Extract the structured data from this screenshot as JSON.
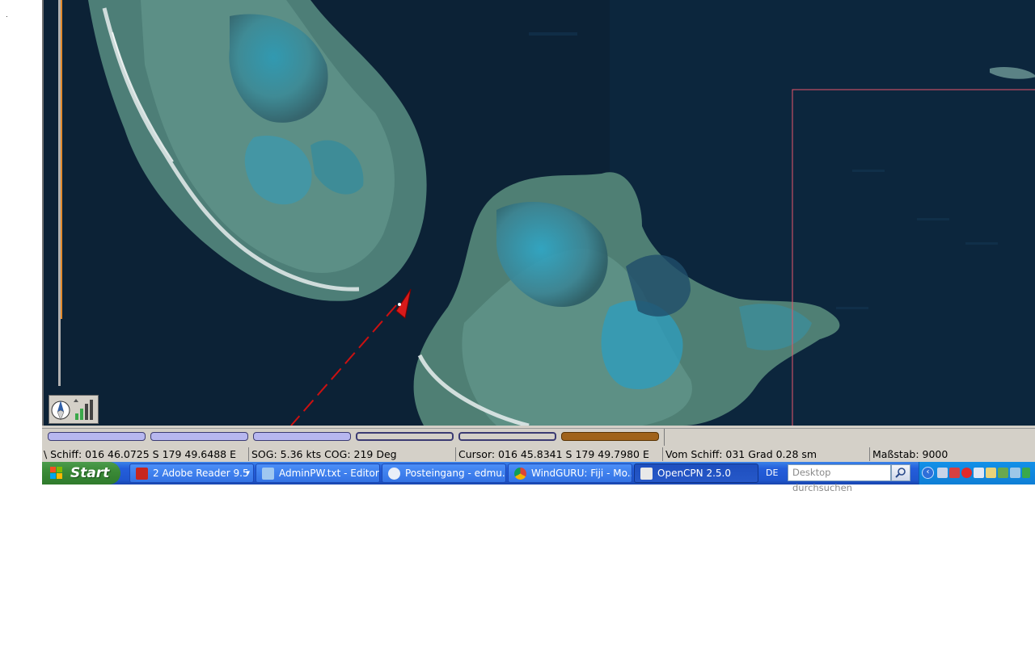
{
  "piano_keys": [
    {
      "state": "filled"
    },
    {
      "state": "filled"
    },
    {
      "state": "filled"
    },
    {
      "state": "hollow"
    },
    {
      "state": "hollow"
    },
    {
      "state": "selected"
    }
  ],
  "status_bar": {
    "ship": "\\ Schiff: 016 46.0725 S   179 49.6488 E",
    "sog_cog": "SOG:  5.36 kts  COG:   219 Deg",
    "cursor": "Cursor: 016 45.8341 S 179 49.7980 E",
    "from_ship": "Vom Schiff: 031 Grad     0.28 sm",
    "scale": "Maßstab:     9000"
  },
  "taskbar": {
    "start_label": "Start",
    "buttons": [
      {
        "label": "2 Adobe Reader 9.5",
        "icon": "pdf-icon",
        "color": "#c8261e"
      },
      {
        "label": "AdminPW.txt - Editor",
        "icon": "notepad-icon",
        "color": "#9fc7f0"
      },
      {
        "label": "Posteingang - edmu...",
        "icon": "mail-icon",
        "color": "#e9eef8"
      },
      {
        "label": "WindGURU: Fiji - Mo...",
        "icon": "chrome-icon",
        "color": "#f2c037"
      },
      {
        "label": "OpenCPN 2.5.0",
        "icon": "opencpn-icon",
        "color": "#e8e8e8"
      }
    ],
    "language": "DE",
    "search_placeholder": "Desktop durchsuchen"
  },
  "colors": {
    "track": "#cc1111",
    "boat": "#d81a1a",
    "chart_border": "#e8556a",
    "piano_selected": "#a0621a",
    "piano_filled": "#b7b7ef"
  }
}
